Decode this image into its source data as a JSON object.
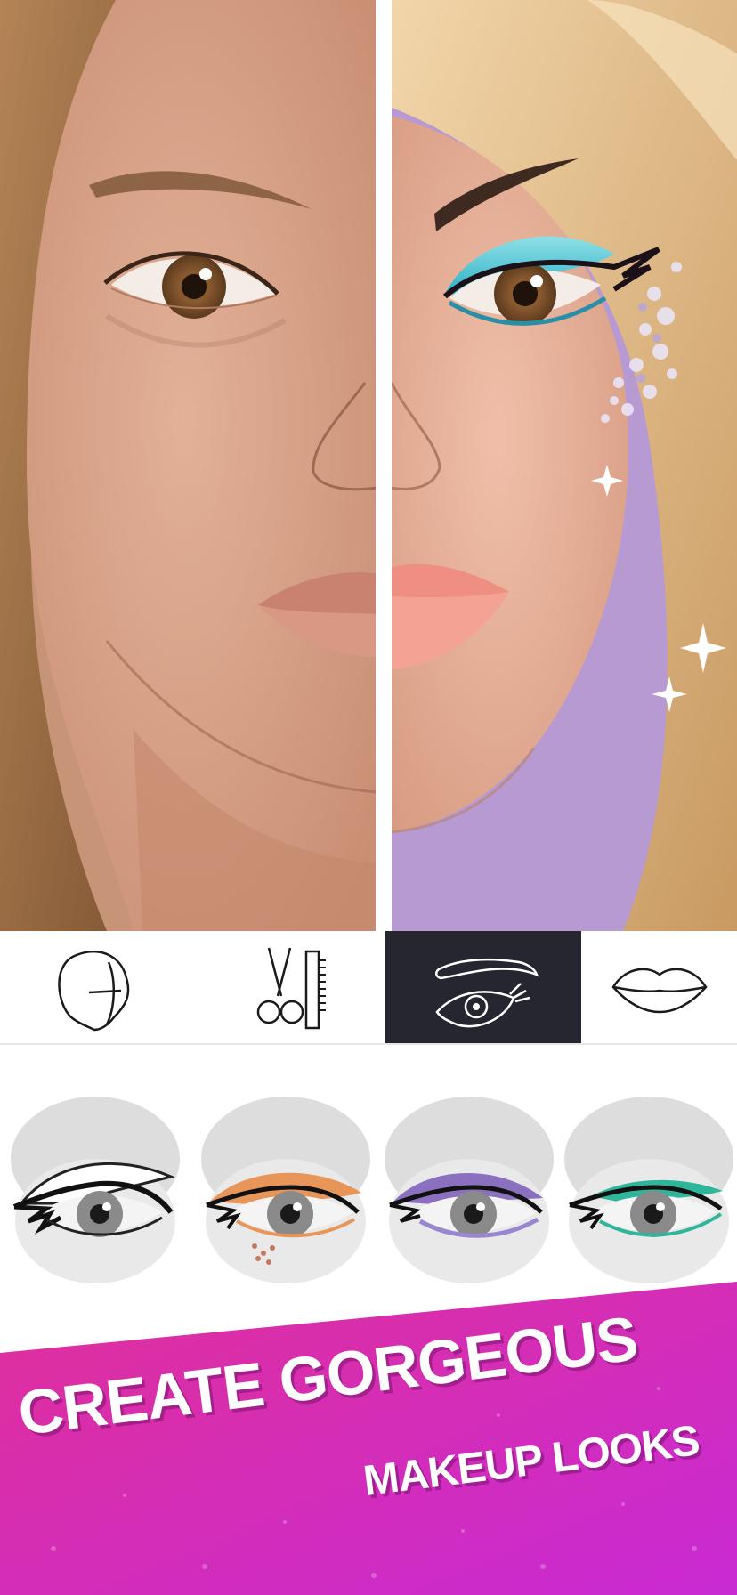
{
  "tabs": [
    {
      "id": "face",
      "icon": "face-shape-icon",
      "active": false
    },
    {
      "id": "hair",
      "icon": "scissors-comb-icon",
      "active": false
    },
    {
      "id": "eyes",
      "icon": "eye-brow-icon",
      "active": true
    },
    {
      "id": "lips",
      "icon": "lips-icon",
      "active": false
    }
  ],
  "presets": [
    {
      "style": "black winged liner",
      "shadow_color": "#ffffff"
    },
    {
      "style": "orange glitter shadow",
      "shadow_color": "#e8955a"
    },
    {
      "style": "purple glitter shadow",
      "shadow_color": "#8c70c0"
    },
    {
      "style": "teal shadow",
      "shadow_color": "#2fb59a"
    }
  ],
  "banner": {
    "line1": "CREATE GORGEOUS",
    "line2": "MAKEUP LOOKS",
    "color_start": "#e0309a",
    "color_end": "#c82ad4"
  },
  "colors": {
    "skin_bare": "#d9a58a",
    "skin_madeup": "#e9b29c",
    "hair_bare": "#9a6a42",
    "hair_madeup": "#e3c08f",
    "eyeshadow": "#47c1d2",
    "lips": "#ee8f83",
    "background_purple": "#b79ad2",
    "tab_active": "#262630"
  }
}
